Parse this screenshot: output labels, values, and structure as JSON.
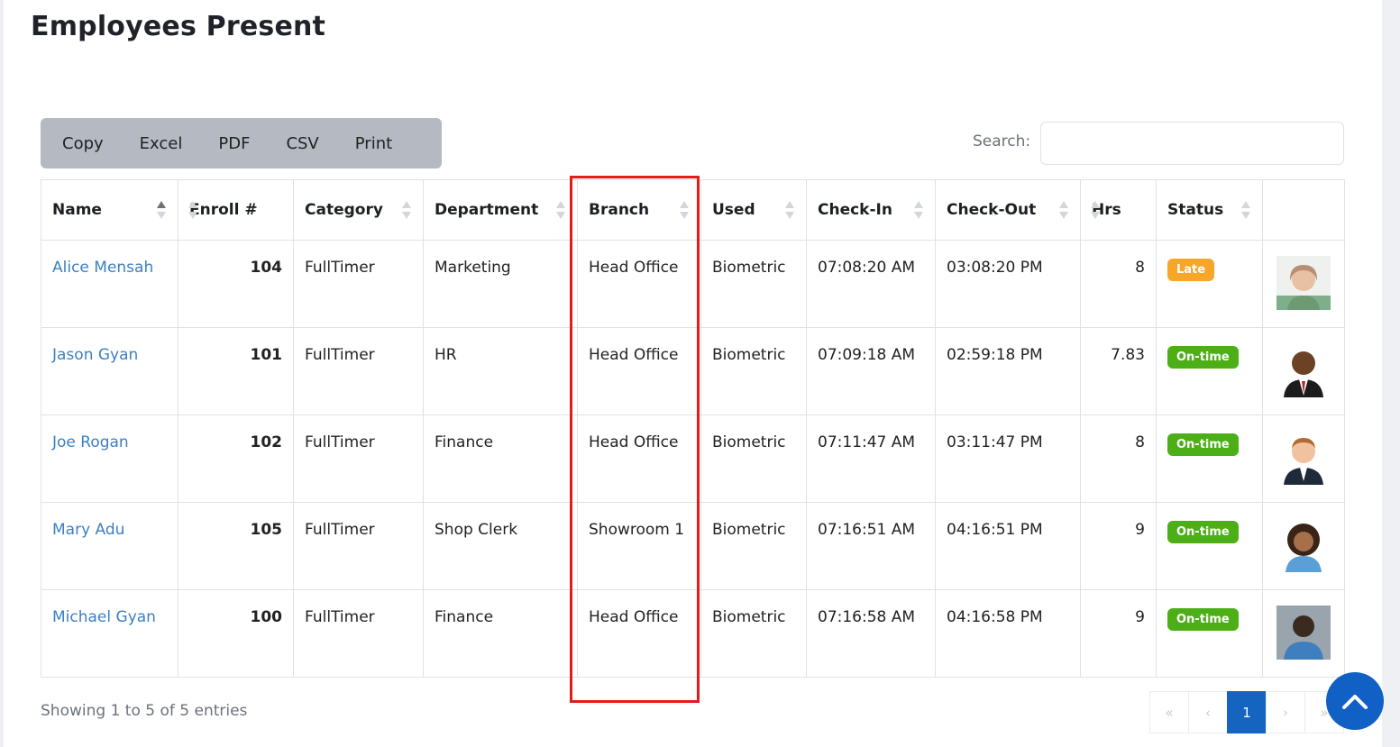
{
  "page": {
    "title": "Employees Present"
  },
  "toolbar": {
    "buttons": [
      "Copy",
      "Excel",
      "PDF",
      "CSV",
      "Print"
    ]
  },
  "search": {
    "label": "Search:",
    "value": "",
    "placeholder": ""
  },
  "table": {
    "columns": [
      "Name",
      "Enroll #",
      "Category",
      "Department",
      "Branch",
      "Used",
      "Check-In",
      "Check-Out",
      "Hrs",
      "Status",
      ""
    ],
    "sorted_column": "Name",
    "sort_direction": "ascending",
    "rows": [
      {
        "name": "Alice Mensah",
        "enroll": "104",
        "category": "FullTimer",
        "department": "Marketing",
        "branch": "Head Office",
        "used": "Biometric",
        "check_in": "07:08:20 AM",
        "check_out": "03:08:20 PM",
        "hrs": "8",
        "status": "Late",
        "status_color": "#f7a62a",
        "avatar": "woman-older-photo"
      },
      {
        "name": "Jason Gyan",
        "enroll": "101",
        "category": "FullTimer",
        "department": "HR",
        "branch": "Head Office",
        "used": "Biometric",
        "check_in": "07:09:18 AM",
        "check_out": "02:59:18 PM",
        "hrs": "7.83",
        "status": "On-time",
        "status_color": "#4caf17",
        "avatar": "man-suit-photo"
      },
      {
        "name": "Joe Rogan",
        "enroll": "102",
        "category": "FullTimer",
        "department": "Finance",
        "branch": "Head Office",
        "used": "Biometric",
        "check_in": "07:11:47 AM",
        "check_out": "03:11:47 PM",
        "hrs": "8",
        "status": "On-time",
        "status_color": "#4caf17",
        "avatar": "man-smiling-photo"
      },
      {
        "name": "Mary Adu",
        "enroll": "105",
        "category": "FullTimer",
        "department": "Shop Clerk",
        "branch": "Showroom 1",
        "used": "Biometric",
        "check_in": "07:16:51 AM",
        "check_out": "04:16:51 PM",
        "hrs": "9",
        "status": "On-time",
        "status_color": "#4caf17",
        "avatar": "woman-curly-hair-photo"
      },
      {
        "name": "Michael Gyan",
        "enroll": "100",
        "category": "FullTimer",
        "department": "Finance",
        "branch": "Head Office",
        "used": "Biometric",
        "check_in": "07:16:58 AM",
        "check_out": "04:16:58 PM",
        "hrs": "9",
        "status": "On-time",
        "status_color": "#4caf17",
        "avatar": "man-blue-shirt-photo"
      }
    ]
  },
  "footer": {
    "info": "Showing 1 to 5 of 5 entries",
    "pagination": [
      "«",
      "‹",
      "1",
      "›",
      "»"
    ],
    "current_page": "1"
  },
  "highlight": {
    "column": "Branch",
    "color": "#e31b1b"
  },
  "colors": {
    "link": "#3c7fc4",
    "primary": "#1565c0",
    "toolbar_bg": "#b5b9c1"
  },
  "icons": {
    "scroll_top": "chevron-up-icon",
    "sort": "sort-arrows-icon"
  }
}
